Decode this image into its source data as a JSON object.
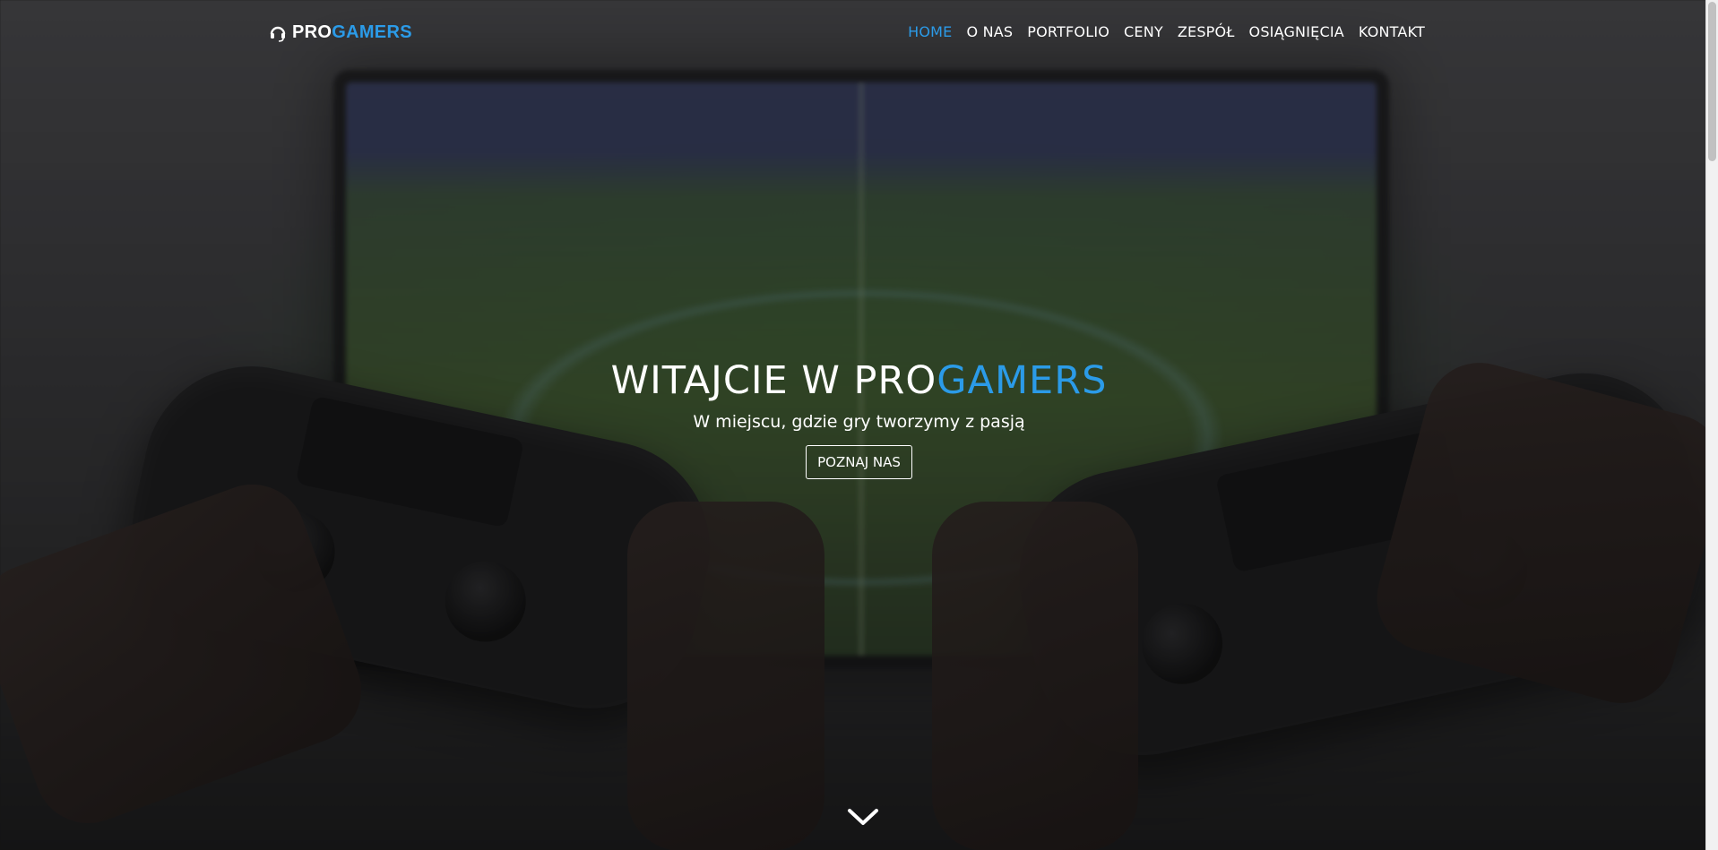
{
  "brand": {
    "part1": "PRO",
    "part2": "GAMERS",
    "icon": "headset-icon"
  },
  "nav": {
    "items": [
      {
        "label": "HOME",
        "active": true
      },
      {
        "label": "O NAS",
        "active": false
      },
      {
        "label": "PORTFOLIO",
        "active": false
      },
      {
        "label": "CENY",
        "active": false
      },
      {
        "label": "ZESPÓŁ",
        "active": false
      },
      {
        "label": "OSIĄGNIĘCIA",
        "active": false
      },
      {
        "label": "KONTAKT",
        "active": false
      }
    ]
  },
  "hero": {
    "title_part1": "WITAJCIE W PRO",
    "title_part2": "GAMERS",
    "subtitle": "W miejscu, gdzie gry tworzymy z pasją",
    "button_label": "POZNAJ NAS",
    "scroll_icon": "chevron-down-icon"
  },
  "colors": {
    "accent": "#2b9be8",
    "text": "#ffffff"
  }
}
